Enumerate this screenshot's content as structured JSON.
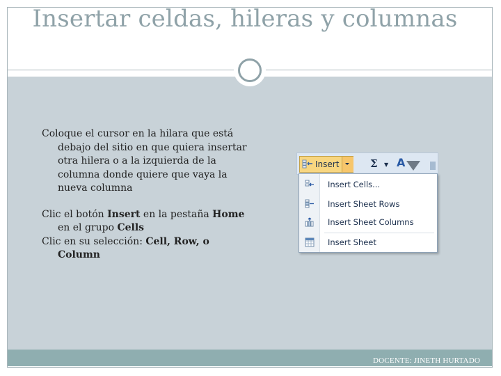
{
  "slide": {
    "title": "Insertar celdas, hileras y columnas",
    "paragraphs": [
      {
        "text": "Coloque el cursor en la hilara que está debajo del sitio en que quiera insertar otra hilera o a la izquierda de la columna donde quiere que vaya la nueva columna"
      }
    ],
    "line2": {
      "part1": "Clic el botón ",
      "bold1": "Insert",
      "part2": " en la pestaña ",
      "bold2": "Home",
      "part3": " en el grupo ",
      "bold3": "Cells"
    },
    "line3": {
      "part1": "Clic en su selección: ",
      "bold1": "Cell, Row, o Column"
    },
    "footer": "DOCENTE: JINETH HURTADO"
  },
  "ribbon": {
    "insert_label": "Insert",
    "sigma_label": "Σ",
    "sort_label": "A",
    "icons": {
      "insert": "insert-cells-icon",
      "autosum": "sigma-icon",
      "sort": "sort-filter-icon",
      "find": "funnel-icon"
    }
  },
  "menu": {
    "items": [
      {
        "label": "Insert Cells...",
        "icon": "insert-cells-icon"
      },
      {
        "label": "Insert Sheet Rows",
        "icon": "insert-rows-icon"
      },
      {
        "label": "Insert Sheet Columns",
        "icon": "insert-columns-icon"
      },
      {
        "label": "Insert Sheet",
        "icon": "insert-sheet-icon"
      }
    ]
  },
  "colors": {
    "title": "#8fa2a8",
    "content_bg": "#c8d2d8",
    "footer_bg": "#8faeb0",
    "insert_button": "#f8d680"
  }
}
